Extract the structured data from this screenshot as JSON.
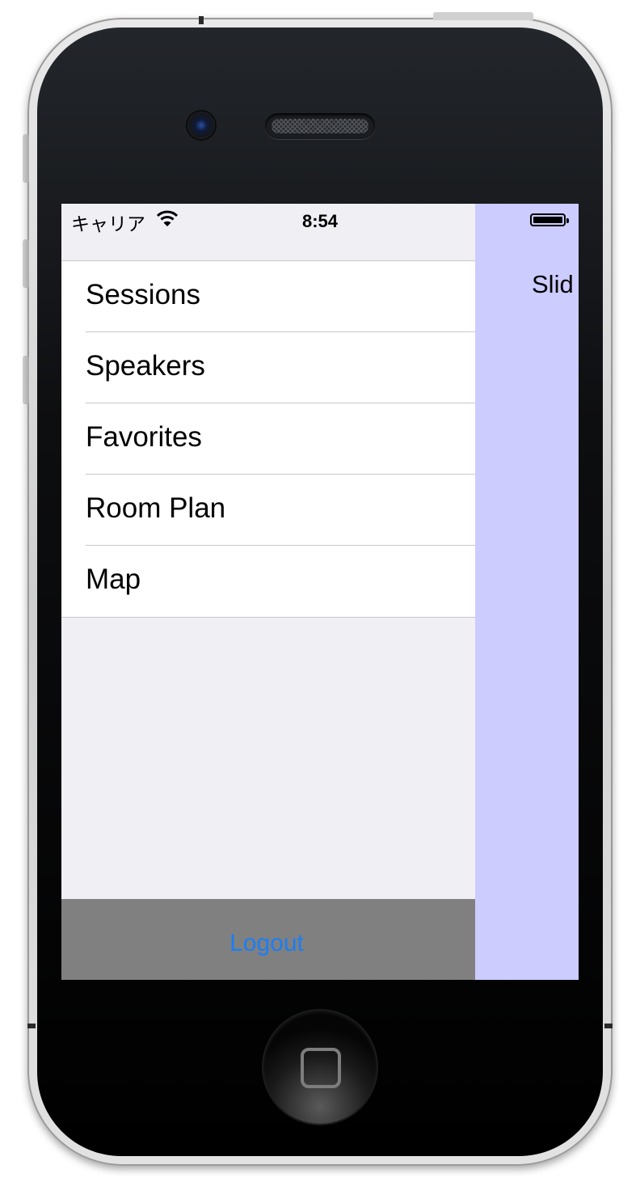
{
  "status_bar": {
    "carrier": "キャリア",
    "time": "8:54",
    "wifi_icon": "wifi-icon",
    "battery_icon": "battery-icon",
    "battery_level": 1.0
  },
  "menu": {
    "items": [
      {
        "label": "Sessions"
      },
      {
        "label": "Speakers"
      },
      {
        "label": "Favorites"
      },
      {
        "label": "Room Plan"
      },
      {
        "label": "Map"
      }
    ],
    "logout_label": "Logout"
  },
  "content": {
    "label": "Slid"
  },
  "colors": {
    "menu_background": "#efeff4",
    "content_background": "#ccccff",
    "logout_bar": "#808080",
    "link_blue": "#1a7ef5"
  }
}
